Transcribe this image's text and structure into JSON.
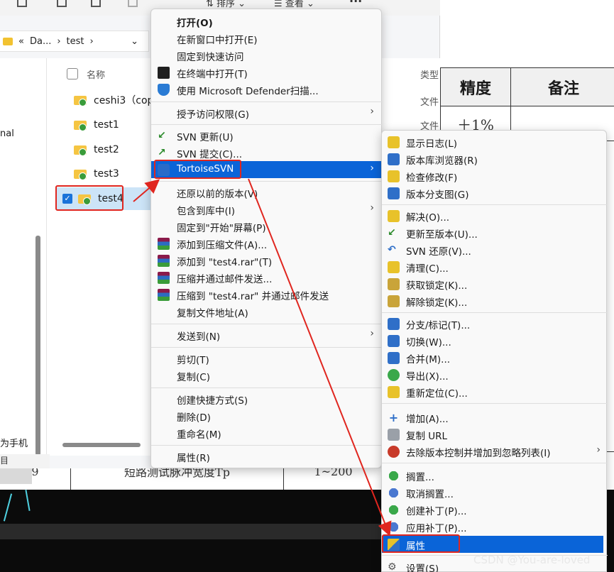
{
  "doc": {
    "header_precision": "精度",
    "header_notes": "备注",
    "precision_value": "＋1%",
    "bottom_row_num": "9",
    "bottom_row_desc": "短路测试脉冲宽度Tp",
    "bottom_row_range": "1~200"
  },
  "explorer": {
    "toolbar": {
      "sort": "排序",
      "view": "查看",
      "more": "···"
    },
    "address": {
      "sep1": "«",
      "crumb1": "Da...",
      "sep2": "›",
      "crumb2": "test",
      "sep3": "›"
    },
    "left_pane_text": "nal",
    "left_pane_bottom": "为手机",
    "status_text": "目",
    "col_name": "名称",
    "col_type": "类型",
    "type_values": [
      "文件",
      "文件"
    ],
    "files": [
      {
        "name": "ceshi3（copy"
      },
      {
        "name": "test1"
      },
      {
        "name": "test2"
      },
      {
        "name": "test3"
      },
      {
        "name": "test4"
      }
    ]
  },
  "context_menu": {
    "open": "打开(O)",
    "open_new_window": "在新窗口中打开(E)",
    "pin_quick_access": "固定到快速访问",
    "open_terminal": "在终端中打开(T)",
    "defender_scan": "使用 Microsoft Defender扫描...",
    "grant_access": "授予访问权限(G)",
    "svn_update": "SVN 更新(U)",
    "svn_commit": "SVN 提交(C)...",
    "tortoise_svn": "TortoiseSVN",
    "restore_previous": "还原以前的版本(V)",
    "include_library": "包含到库中(I)",
    "pin_start": "固定到\"开始\"屏幕(P)",
    "add_archive": "添加到压缩文件(A)...",
    "add_rar": "添加到 \"test4.rar\"(T)",
    "compress_email": "压缩并通过邮件发送...",
    "compress_rar_email": "压缩到 \"test4.rar\" 并通过邮件发送",
    "copy_path": "复制文件地址(A)",
    "send_to": "发送到(N)",
    "cut": "剪切(T)",
    "copy": "复制(C)",
    "create_shortcut": "创建快捷方式(S)",
    "delete": "删除(D)",
    "rename": "重命名(M)",
    "properties": "属性(R)"
  },
  "svn_submenu": {
    "show_log": "显示日志(L)",
    "repo_browser": "版本库浏览器(R)",
    "check_modifications": "检查修改(F)",
    "revision_graph": "版本分支图(G)",
    "resolve": "解决(O)...",
    "update_to_revision": "更新至版本(U)...",
    "svn_revert": "SVN 还原(V)...",
    "cleanup": "清理(C)...",
    "get_lock": "获取锁定(K)...",
    "release_lock": "解除锁定(K)...",
    "branch_tag": "分支/标记(T)...",
    "switch": "切换(W)...",
    "merge": "合并(M)...",
    "export": "导出(X)...",
    "relocate": "重新定位(C)...",
    "add": "增加(A)...",
    "copy_url": "复制 URL",
    "delete_ignore": "去除版本控制并增加到忽略列表(I)",
    "shelve": "搁置...",
    "unshelve": "取消搁置...",
    "create_patch": "创建补丁(P)...",
    "apply_patch": "应用补丁(P)...",
    "properties": "属性",
    "settings": "设置(S)"
  },
  "watermark": "CSDN @You-are-loved",
  "colors": {
    "highlight": "#0a64d8",
    "annotation": "#e0261f"
  }
}
